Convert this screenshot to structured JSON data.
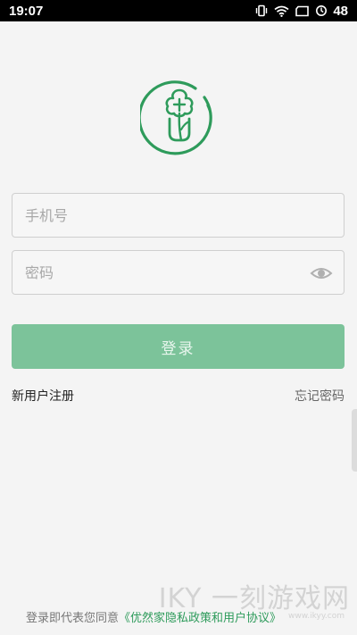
{
  "status_bar": {
    "time": "19:07",
    "battery": "48",
    "icons": [
      "vibrate-icon",
      "wifi-icon",
      "sim-icon",
      "battery-icon"
    ]
  },
  "logo": {
    "icon": "tree-flower-logo-icon",
    "color": "#2e9b5b"
  },
  "form": {
    "phone": {
      "value": "",
      "placeholder": "手机号"
    },
    "password": {
      "value": "",
      "placeholder": "密码",
      "toggle_icon": "eye-icon"
    },
    "login_label": "登录"
  },
  "links": {
    "register": "新用户注册",
    "forgot": "忘记密码"
  },
  "footer": {
    "prefix": "登录即代表您同意",
    "agreement": "《优然家隐私政策和用户协议》"
  },
  "watermark": {
    "text": "IKY 一刻游戏网",
    "sub": "www.ikyy.com"
  },
  "colors": {
    "accent": "#2e9b5b",
    "button": "#7cc39a",
    "background": "#f4f4f4"
  }
}
